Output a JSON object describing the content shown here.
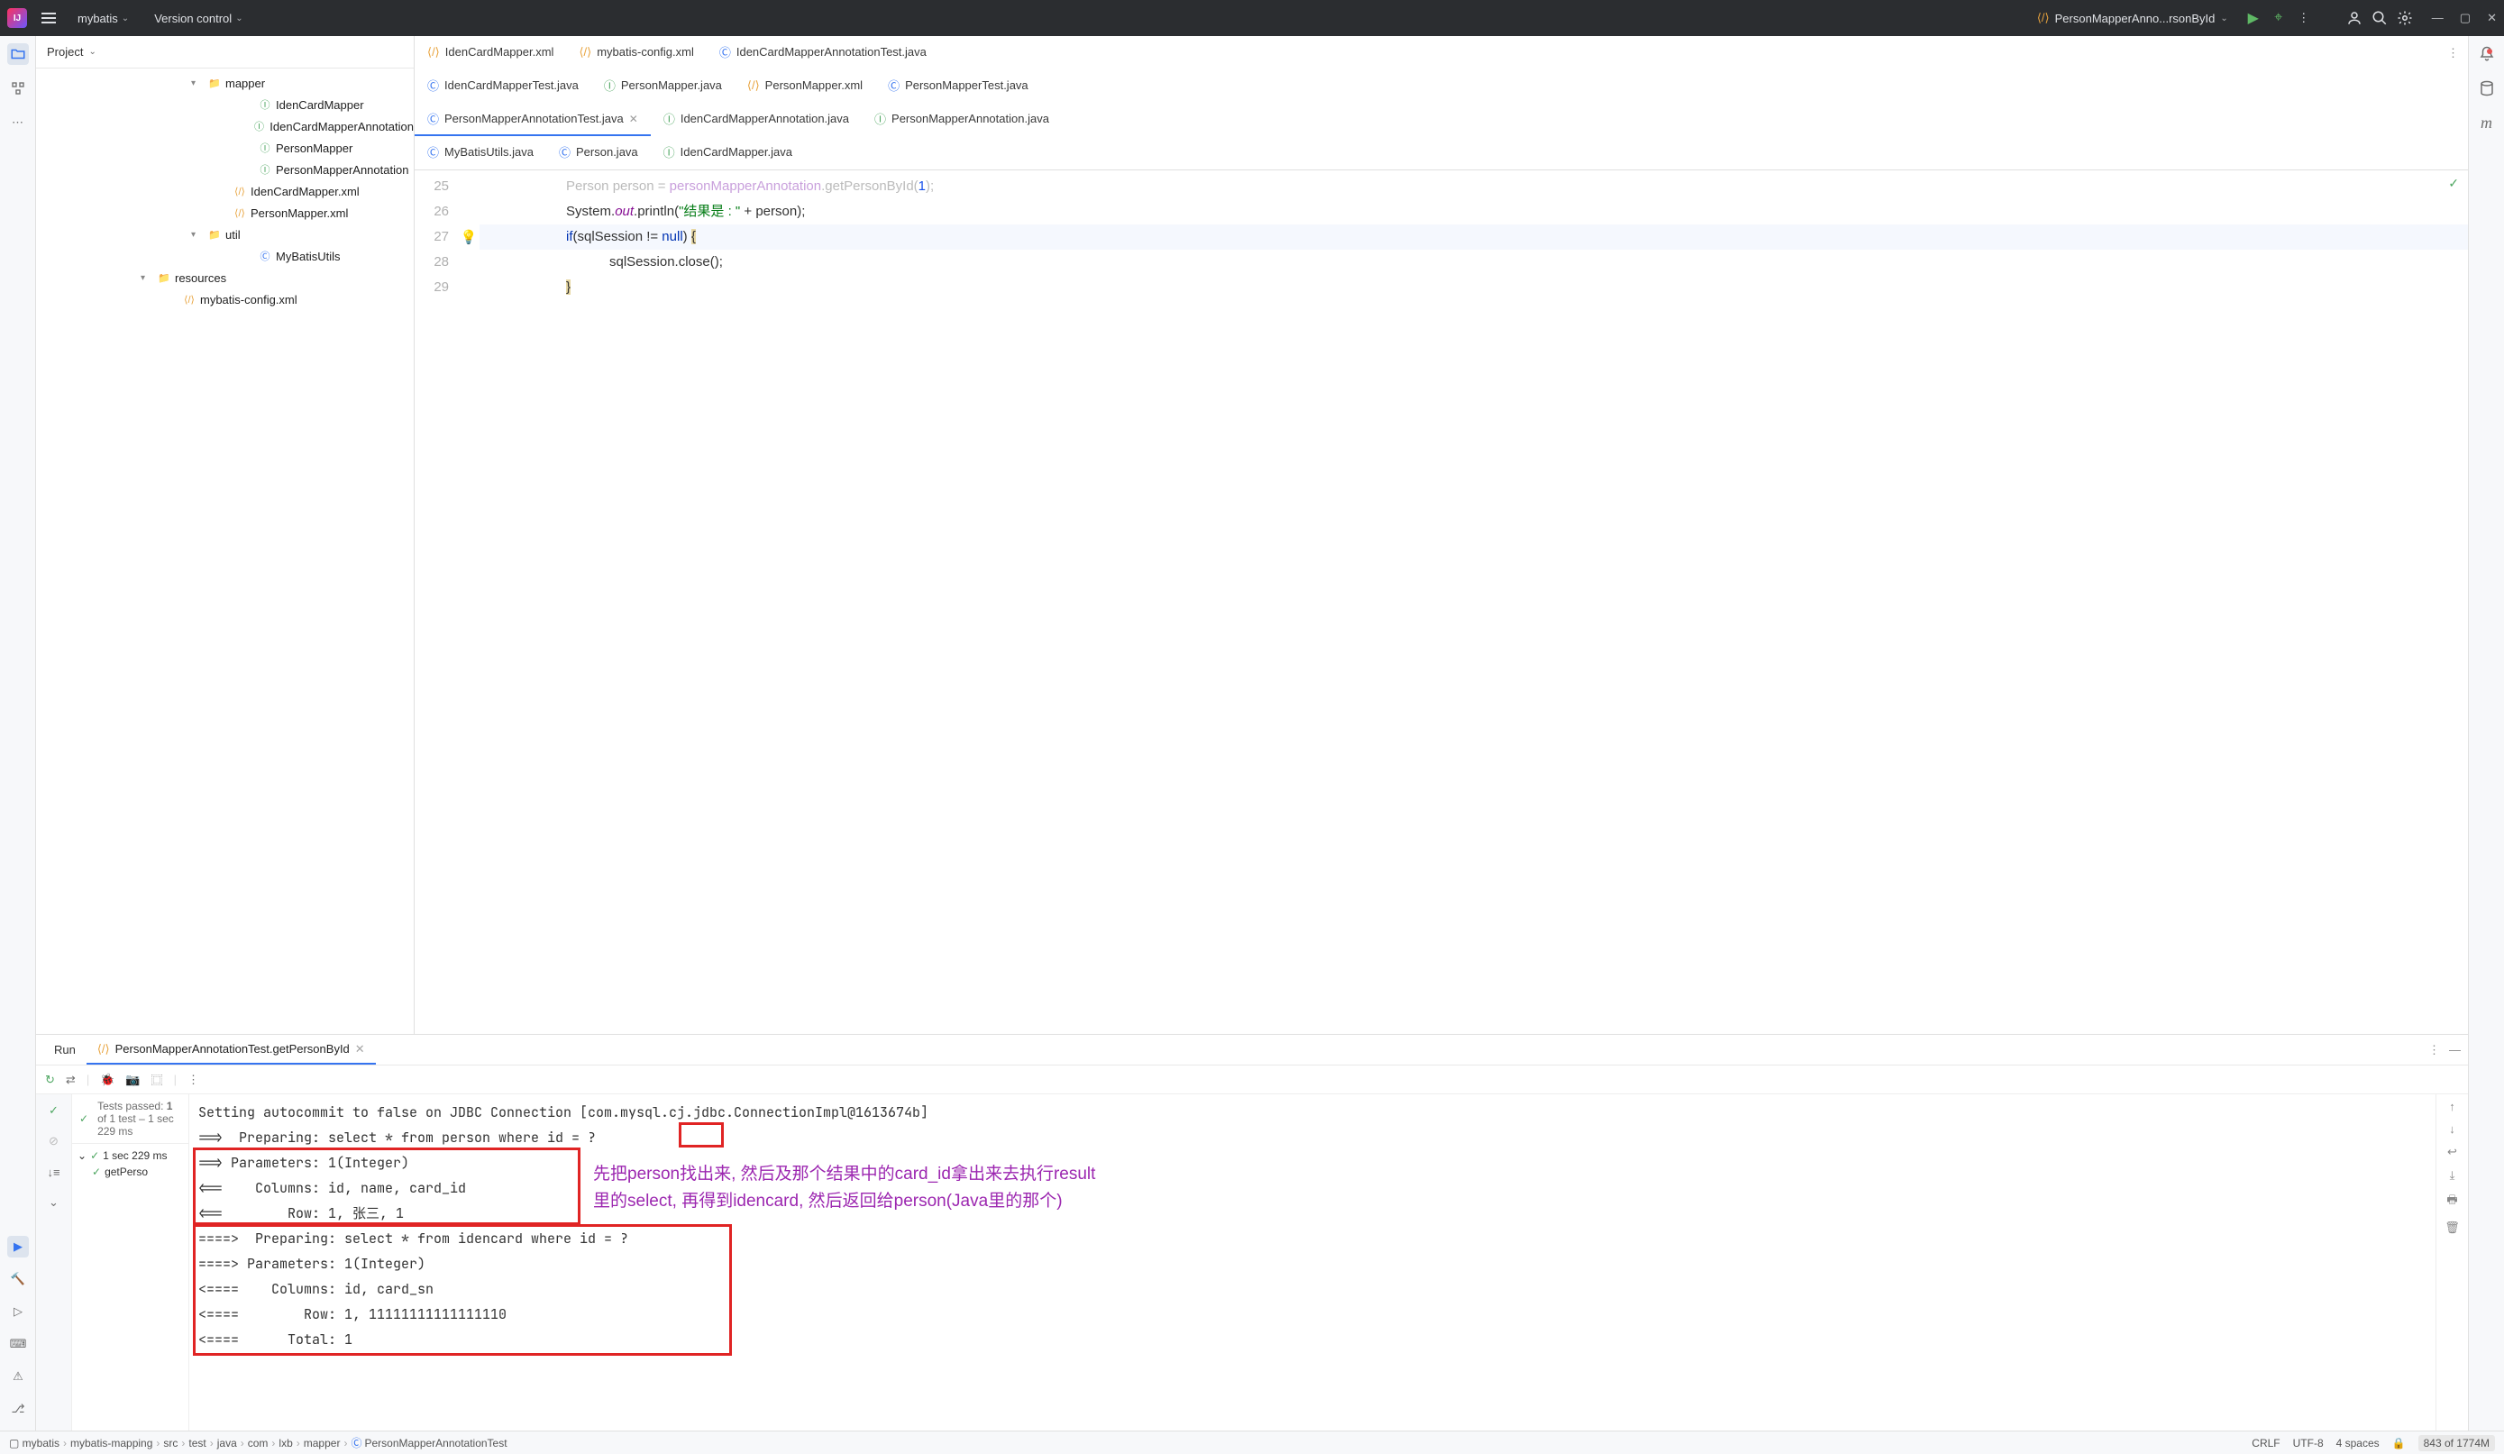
{
  "titlebar": {
    "project": "mybatis",
    "vcs": "Version control",
    "run_config": "PersonMapperAnno...rsonById"
  },
  "project_tool": {
    "title": "Project",
    "tree": [
      {
        "indent": 160,
        "arrow": "▾",
        "icon": "folder",
        "label": "mapper"
      },
      {
        "indent": 216,
        "arrow": "",
        "icon": "iface",
        "label": "IdenCardMapper"
      },
      {
        "indent": 216,
        "arrow": "",
        "icon": "iface",
        "label": "IdenCardMapperAnnotation"
      },
      {
        "indent": 216,
        "arrow": "",
        "icon": "iface",
        "label": "PersonMapper"
      },
      {
        "indent": 216,
        "arrow": "",
        "icon": "iface",
        "label": "PersonMapperAnnotation"
      },
      {
        "indent": 188,
        "arrow": "",
        "icon": "xml",
        "label": "IdenCardMapper.xml"
      },
      {
        "indent": 188,
        "arrow": "",
        "icon": "xml",
        "label": "PersonMapper.xml"
      },
      {
        "indent": 160,
        "arrow": "▾",
        "icon": "folder",
        "label": "util"
      },
      {
        "indent": 216,
        "arrow": "",
        "icon": "class",
        "label": "MyBatisUtils"
      },
      {
        "indent": 104,
        "arrow": "▾",
        "icon": "folder",
        "label": "resources"
      },
      {
        "indent": 132,
        "arrow": "",
        "icon": "xml",
        "label": "mybatis-config.xml"
      }
    ]
  },
  "editor": {
    "tabs_row1": [
      {
        "icon": "xml",
        "label": "IdenCardMapper.xml"
      },
      {
        "icon": "xml",
        "label": "mybatis-config.xml"
      },
      {
        "icon": "class",
        "label": "IdenCardMapperAnnotationTest.java"
      }
    ],
    "tabs_row2": [
      {
        "icon": "class",
        "label": "IdenCardMapperTest.java"
      },
      {
        "icon": "iface",
        "label": "PersonMapper.java"
      },
      {
        "icon": "xml",
        "label": "PersonMapper.xml"
      },
      {
        "icon": "class",
        "label": "PersonMapperTest.java"
      }
    ],
    "tabs_row3": [
      {
        "icon": "class",
        "label": "PersonMapperAnnotationTest.java",
        "active": true,
        "close": true
      },
      {
        "icon": "iface",
        "label": "IdenCardMapperAnnotation.java"
      },
      {
        "icon": "iface",
        "label": "PersonMapperAnnotation.java"
      }
    ],
    "tabs_row4": [
      {
        "icon": "class",
        "label": "MyBatisUtils.java"
      },
      {
        "icon": "class",
        "label": "Person.java"
      },
      {
        "icon": "iface",
        "label": "IdenCardMapper.java"
      }
    ],
    "lines": [
      "25",
      "26",
      "27",
      "28",
      "29"
    ],
    "code25_partial": "Person person = personMapperAnnotation.getPersonById(1);",
    "code26": {
      "p1": "System.",
      "p2": "out",
      "p3": ".println(",
      "p4": "\"结果是 : \"",
      "p5": " + person);"
    },
    "code27": {
      "p1": "if",
      "p2": "(sqlSession != ",
      "p3": "null",
      "p4": ") "
    },
    "code28": "sqlSession.close();"
  },
  "run": {
    "tab_run": "Run",
    "tab_test": "PersonMapperAnnotationTest.getPersonById",
    "tests_passed_prefix": "Tests passed: ",
    "tests_passed_count": "1",
    "tests_passed_suffix": " of 1 test – 1 sec 229 ms",
    "duration": "1 sec 229 ms",
    "test_name": "getPerso",
    "console_lines": [
      "Setting autocommit to false on JDBC Connection [com.mysql.cj.jdbc.ConnectionImpl@1613674b]",
      "==>  Preparing: select * from person where id = ?",
      "==> Parameters: 1(Integer)",
      "<==    Columns: id, name, card_id",
      "<==        Row: 1, 张三, 1",
      "====>  Preparing: select * from idencard where id = ?",
      "====> Parameters: 1(Integer)",
      "<====    Columns: id, card_sn",
      "<====        Row: 1, 11111111111111110",
      "<====      Total: 1"
    ],
    "annotation_l1": "先把person找出来, 然后及那个结果中的card_id拿出来去执行result",
    "annotation_l2": "里的select, 再得到idencard, 然后返回给person(Java里的那个)"
  },
  "breadcrumb": [
    "mybatis",
    "mybatis-mapping",
    "src",
    "test",
    "java",
    "com",
    "lxb",
    "mapper",
    "PersonMapperAnnotationTest"
  ],
  "status": {
    "crlf": "CRLF",
    "encoding": "UTF-8",
    "indent": "4 spaces",
    "mem": "843 of 1774M"
  }
}
